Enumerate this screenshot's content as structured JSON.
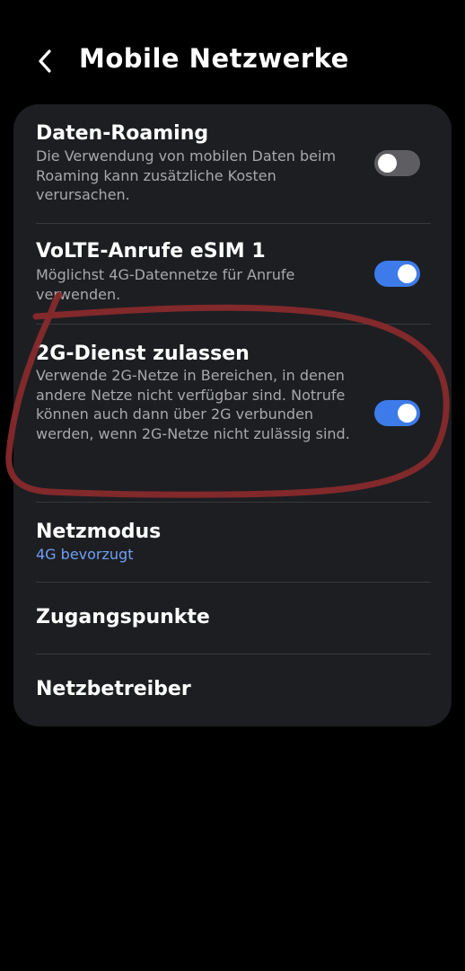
{
  "header": {
    "title": "Mobile Netzwerke",
    "back_icon": "chevron-left-icon"
  },
  "settings": {
    "data_roaming": {
      "title": "Daten-Roaming",
      "description": "Die Verwendung von mobilen Daten beim Roaming kann zusätzliche Kosten verursachen.",
      "enabled": false
    },
    "volte": {
      "title": "VoLTE-Anrufe eSIM 1",
      "description": "Möglichst 4G-Datennetze für Anrufe verwenden.",
      "enabled": true
    },
    "allow_2g": {
      "title": "2G-Dienst zulassen",
      "description": "Verwende 2G-Netze in Bereichen, in denen andere Netze nicht verfügbar sind. Notrufe können auch dann über 2G verbunden werden, wenn 2G-Netze nicht zulässig sind.",
      "enabled": true
    },
    "network_mode": {
      "title": "Netzmodus",
      "value": "4G bevorzugt"
    },
    "access_points": {
      "title": "Zugangspunkte"
    },
    "operators": {
      "title": "Netzbetreiber"
    }
  },
  "colors": {
    "background": "#000000",
    "card": "#1d1e22",
    "toggle_on": "#3d7bea",
    "toggle_off": "#5e5e62",
    "accent_text": "#6f9ff2",
    "annotation": "#8a2a2d"
  }
}
